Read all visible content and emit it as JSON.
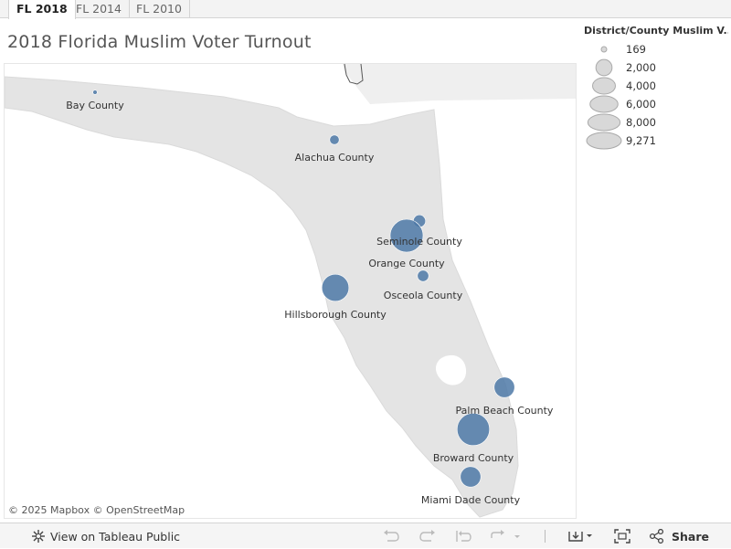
{
  "tabs": [
    {
      "label": "FL 2018",
      "active": true
    },
    {
      "label": "FL 2014",
      "active": false
    },
    {
      "label": "FL 2010",
      "active": false
    }
  ],
  "title": "2018 Florida Muslim Voter Turnout",
  "map": {
    "attribution": "© 2025 Mapbox © OpenStreetMap",
    "bubble_color": "#4e79a7",
    "land_color": "#e4e4e4",
    "counties": [
      {
        "name": "Bay County",
        "value": 169
      },
      {
        "name": "Alachua County",
        "value": 780
      },
      {
        "name": "Seminole County",
        "value": 1300
      },
      {
        "name": "Orange County",
        "value": 9271
      },
      {
        "name": "Osceola County",
        "value": 1100
      },
      {
        "name": "Hillsborough County",
        "value": 6300
      },
      {
        "name": "Palm Beach County",
        "value": 3600
      },
      {
        "name": "Broward County",
        "value": 9000
      },
      {
        "name": "Miami Dade County",
        "value": 3600
      }
    ]
  },
  "legend": {
    "title": "District/County Muslim V...",
    "items": [
      {
        "label": "169",
        "value": 169
      },
      {
        "label": "2,000",
        "value": 2000
      },
      {
        "label": "4,000",
        "value": 4000
      },
      {
        "label": "6,000",
        "value": 6000
      },
      {
        "label": "8,000",
        "value": 8000
      },
      {
        "label": "9,271",
        "value": 9271
      }
    ]
  },
  "toolbar": {
    "view_label": "View on Tableau Public",
    "share_label": "Share"
  }
}
